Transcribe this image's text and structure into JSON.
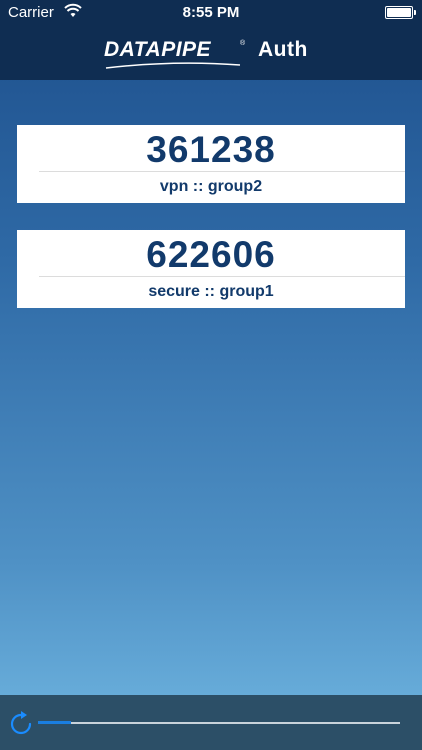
{
  "status_bar": {
    "carrier": "Carrier",
    "time": "8:55 PM",
    "wifi_icon": "wifi-icon",
    "battery_icon": "battery-icon"
  },
  "nav": {
    "logo_text": "DATAPIPE",
    "logo_tm": "®",
    "title": "Auth"
  },
  "tokens": [
    {
      "code": "361238",
      "label": "vpn :: group2"
    },
    {
      "code": "622606",
      "label": "secure :: group1"
    }
  ],
  "toolbar": {
    "refresh_icon": "refresh-icon",
    "progress": 0.09
  },
  "colors": {
    "nav_bg": "#0f2d52",
    "code_text": "#123a6b",
    "toolbar_bg": "#2c4f67",
    "progress_fill": "#1a7ee0",
    "accent_refresh": "#1a8cff"
  }
}
